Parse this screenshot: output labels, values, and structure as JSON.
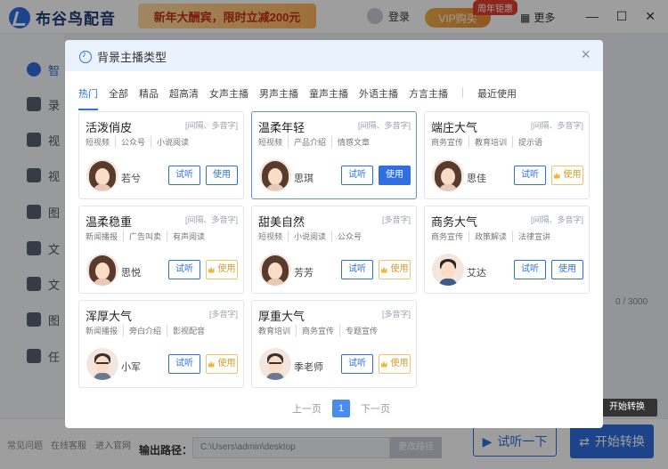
{
  "app": {
    "logo_text": "布谷鸟配音",
    "promo_text": "新年大酬宾，限时立减200元",
    "login_label": "登录",
    "vip_label": "VIP购买",
    "vip_badge": "周年钜惠",
    "more_label": "更多",
    "window_minimize": "—",
    "window_maximize": "☐",
    "window_close": "✕",
    "sidebar_items": [
      "智",
      "录",
      "视",
      "视",
      "图",
      "文",
      "文",
      "图",
      "任"
    ],
    "bottom_links": [
      "常见问题",
      "在线客服",
      "进入官网"
    ],
    "output_path_label": "输出路径：",
    "output_path_value": "C:\\Users\\admin\\desktop",
    "change_path_label": "更改路径",
    "try_label": "试听一下",
    "start_label": "开始转换",
    "tooltip": "开始转换",
    "char_counter": "0 / 3000"
  },
  "modal": {
    "title": "背景主播类型",
    "close_icon": "×",
    "tabs": [
      "热门",
      "全部",
      "精品",
      "超高清",
      "女声主播",
      "男声主播",
      "童声主播",
      "外语主播",
      "方言主播",
      "最近使用"
    ],
    "active_tab": "热门",
    "listen_label": "试听",
    "use_label": "使用",
    "cards": [
      {
        "title": "活泼俏皮",
        "tag": "[间隔、多音字]",
        "cats": [
          "短视频",
          "公众号",
          "小说阅读"
        ],
        "speaker": "若兮",
        "use_style": "normal",
        "avatar": "female"
      },
      {
        "title": "温柔年轻",
        "tag": "[间隔、多音字]",
        "cats": [
          "短视频",
          "产品介绍",
          "情感文章"
        ],
        "speaker": "思琪",
        "use_style": "primary",
        "avatar": "female"
      },
      {
        "title": "端庄大气",
        "tag": "[间隔、多音字]",
        "cats": [
          "商务宣传",
          "教育培训",
          "提示语"
        ],
        "speaker": "思佳",
        "use_style": "vip",
        "avatar": "female"
      },
      {
        "title": "温柔稳重",
        "tag": "[间隔、多音字]",
        "cats": [
          "新闻播报",
          "广告叫卖",
          "有声阅读"
        ],
        "speaker": "思悦",
        "use_style": "vip",
        "avatar": "female"
      },
      {
        "title": "甜美自然",
        "tag": "[多音字]",
        "cats": [
          "短视频",
          "小说阅读",
          "公众号"
        ],
        "speaker": "芳芳",
        "use_style": "vip",
        "avatar": "female"
      },
      {
        "title": "商务大气",
        "tag": "[间隔、多音字]",
        "cats": [
          "商务宣传",
          "政策解读",
          "法律宣讲"
        ],
        "speaker": "艾达",
        "use_style": "normal",
        "avatar": "male"
      },
      {
        "title": "浑厚大气",
        "tag": "[多音字]",
        "cats": [
          "新闻播报",
          "旁白介绍",
          "影视配音"
        ],
        "speaker": "小军",
        "use_style": "vip",
        "avatar": "male-glasses"
      },
      {
        "title": "厚重大气",
        "tag": "[多音字]",
        "cats": [
          "教育培训",
          "商务宣传",
          "专题宣传"
        ],
        "speaker": "季老师",
        "use_style": "vip",
        "avatar": "male-glasses"
      }
    ],
    "pager": {
      "prev": "上一页",
      "current": "1",
      "next": "下一页"
    }
  },
  "colors": {
    "accent": "#2f6fe0",
    "vip": "#f2b53a"
  }
}
